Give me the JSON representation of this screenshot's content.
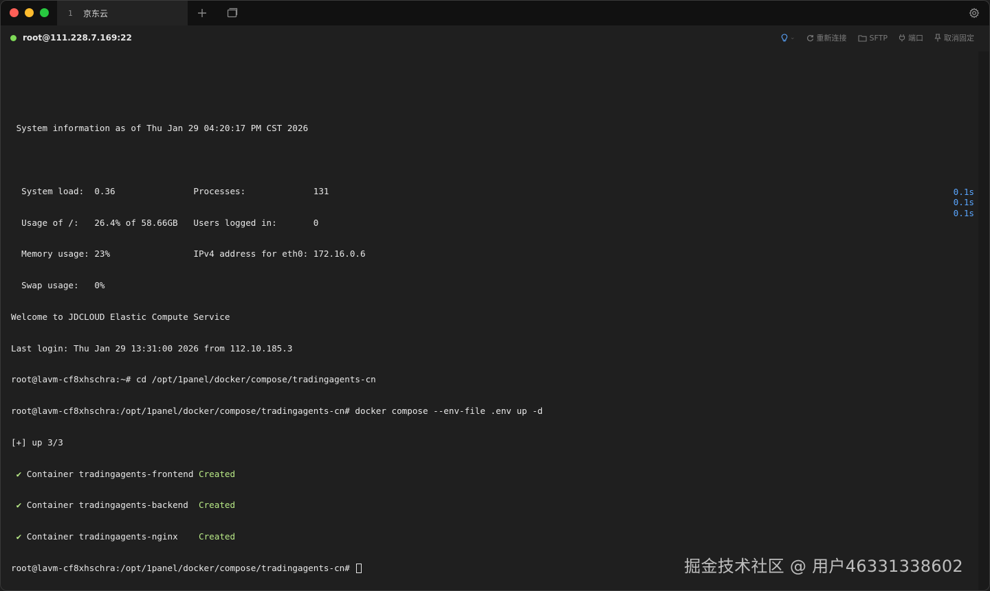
{
  "tab": {
    "index": "1",
    "title": "京东云"
  },
  "session": {
    "host": "root@111.228.7.169:22",
    "actions": {
      "reconnect": "重新连接",
      "sftp": "SFTP",
      "port": "端口",
      "unpin": "取消固定"
    }
  },
  "terminal": {
    "lines": [
      "",
      " System information as of Thu Jan 29 04:20:17 PM CST 2026",
      "",
      "  System load:  0.36               Processes:             131",
      "  Usage of /:   26.4% of 58.66GB   Users logged in:       0",
      "  Memory usage: 23%                IPv4 address for eth0: 172.16.0.6",
      "  Swap usage:   0%",
      "Welcome to JDCLOUD Elastic Compute Service",
      "Last login: Thu Jan 29 13:31:00 2026 from 112.10.185.3",
      "root@lavm-cf8xhschra:~# cd /opt/1panel/docker/compose/tradingagents-cn",
      "root@lavm-cf8xhschra:/opt/1panel/docker/compose/tradingagents-cn# docker compose --env-file .env up -d",
      "[+] up 3/3"
    ],
    "containers": [
      {
        "check": "✔",
        "text": " Container tradingagents-frontend ",
        "status": "Created",
        "time": "0.1s"
      },
      {
        "check": "✔",
        "text": " Container tradingagents-backend  ",
        "status": "Created",
        "time": "0.1s"
      },
      {
        "check": "✔",
        "text": " Container tradingagents-nginx    ",
        "status": "Created",
        "time": "0.1s"
      }
    ],
    "prompt": "root@lavm-cf8xhschra:/opt/1panel/docker/compose/tradingagents-cn# "
  },
  "watermark": "掘金技术社区 @ 用户46331338602",
  "colors": {
    "accent_green": "#b8e986",
    "timing_blue": "#5aa6ff",
    "status_dot": "#7ed957"
  }
}
